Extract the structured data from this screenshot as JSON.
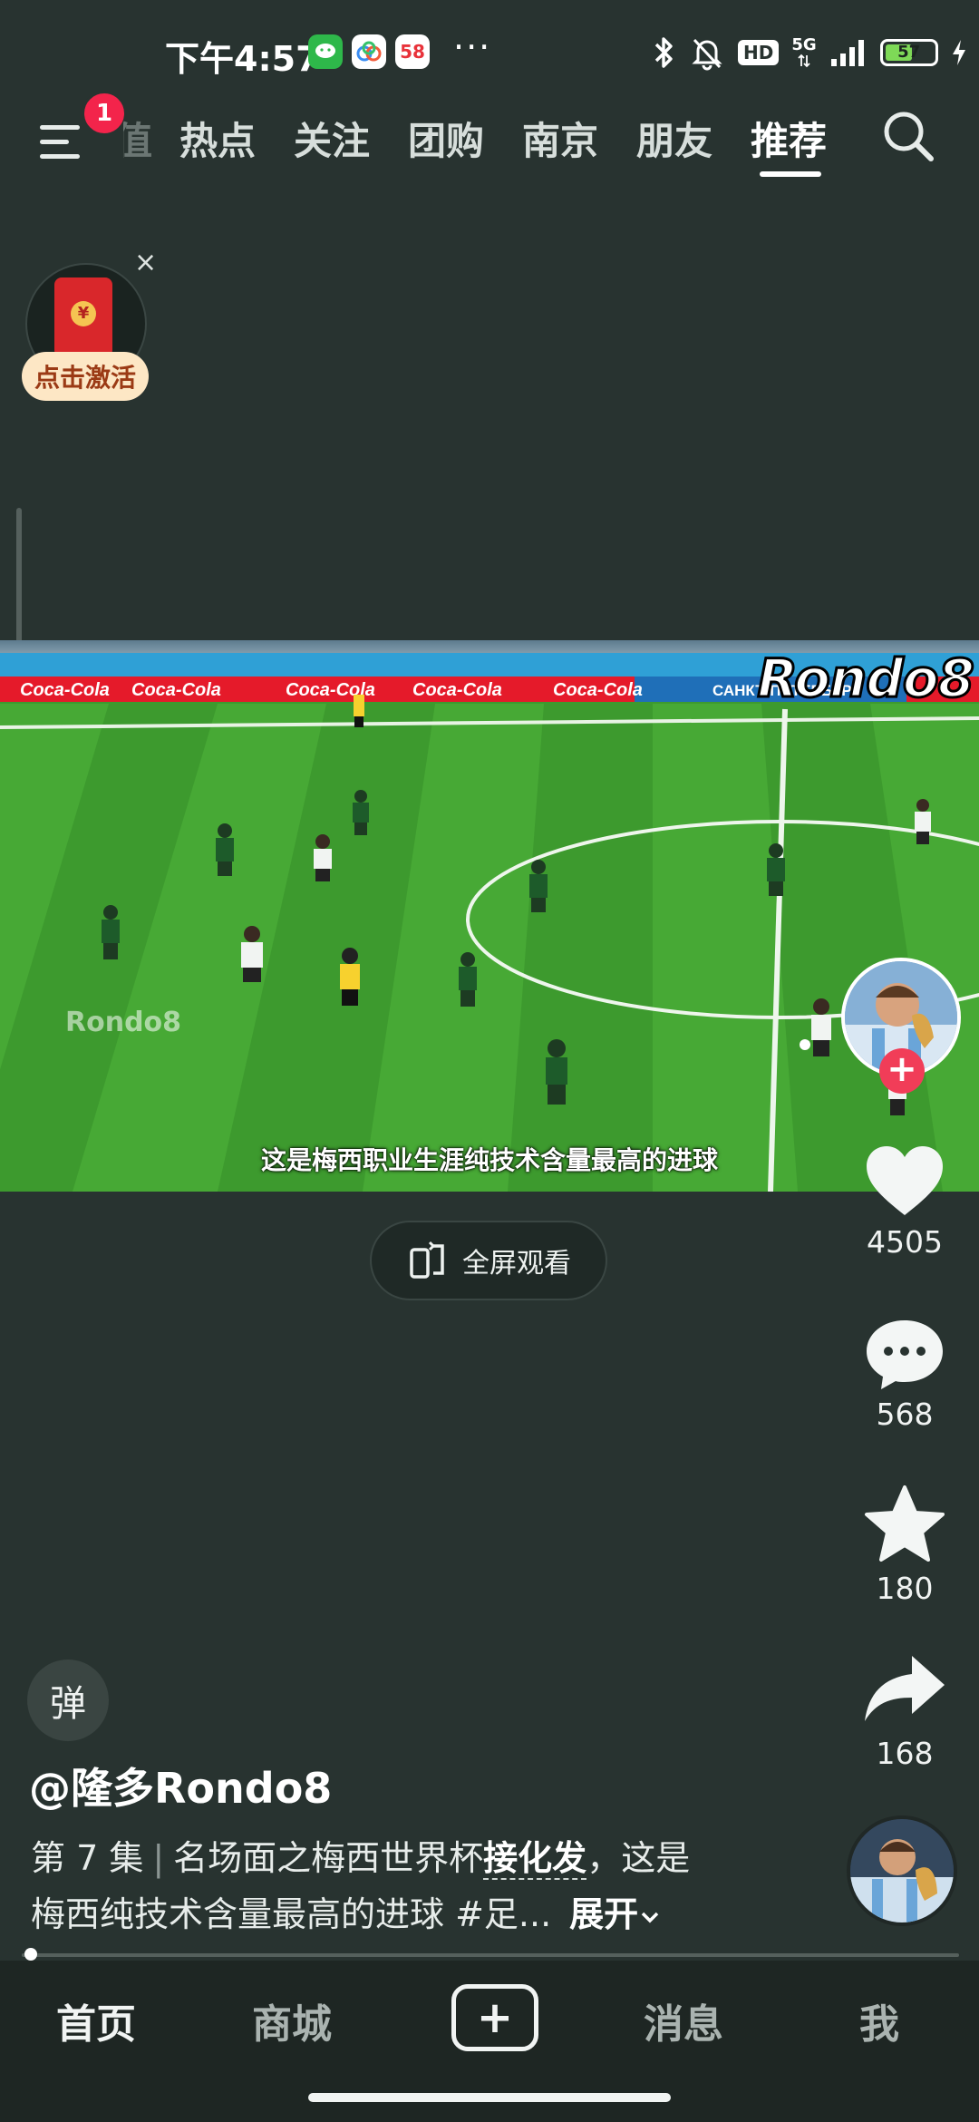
{
  "status_bar": {
    "time": "下午4:57",
    "app_badge_58": "58",
    "more": "···",
    "hd": "HD",
    "network": "5G",
    "battery": "57",
    "battery_level": 0.57
  },
  "top_nav": {
    "menu_badge": "1",
    "partial_tab": "值",
    "tabs": [
      "热点",
      "关注",
      "团购",
      "南京",
      "朋友",
      "推荐"
    ],
    "active_tab": "推荐"
  },
  "red_packet": {
    "close": "×",
    "seal": "¥",
    "label": "点击激活"
  },
  "video": {
    "watermark": "Rondo8",
    "watermark_inner": "Rondo8",
    "subtitle": "这是梅西职业生涯纯技术含量最高的进球",
    "fullscreen_label": "全屏观看",
    "ad_boards": [
      "Coca-Cola",
      "Coca-Cola",
      "Coca-Cola",
      "Coca-Cola",
      "Coca-Cola",
      "САНКТ-ПЕТЕРБУРГ"
    ]
  },
  "right_rail": {
    "follow": "+",
    "likes": "4505",
    "comments": "568",
    "favorites": "180",
    "shares": "168"
  },
  "danmu_label": "弹",
  "post": {
    "author": "@隆多Rondo8",
    "episode": "第 7 集",
    "separator": "|",
    "title_prefix": "名场面之梅西世界杯",
    "title_link": "接化发",
    "title_suffix": "，这是",
    "line2": "梅西纯技术含量最高的进球 #足...",
    "expand": "展开"
  },
  "playback_progress": 0.01,
  "bottom_nav": {
    "home": "首页",
    "mall": "商城",
    "add": "+",
    "messages": "消息",
    "me": "我"
  },
  "colors": {
    "background": "#283330",
    "bottom_nav": "#1e2623",
    "badge_red": "#f3244b",
    "follow_red": "#f13d58",
    "battery_green": "#7ed957"
  },
  "icons": [
    "menu-icon",
    "search-icon",
    "bluetooth-icon",
    "mute-bell-icon",
    "signal-icon",
    "battery-icon",
    "charging-icon",
    "fullscreen-icon",
    "heart-icon",
    "comment-icon",
    "star-icon",
    "share-icon",
    "chevron-down-icon"
  ]
}
